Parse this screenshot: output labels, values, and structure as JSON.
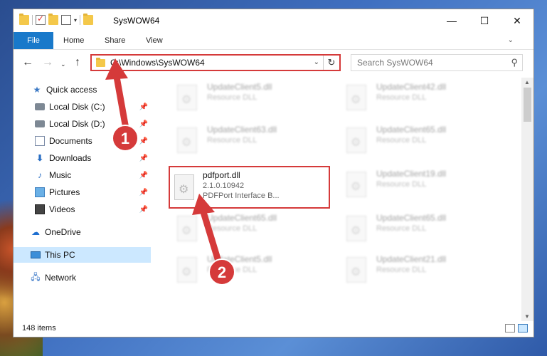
{
  "window": {
    "title": "SysWOW64",
    "minimize": "—",
    "maximize": "☐",
    "close": "✕"
  },
  "ribbon": {
    "tabs": [
      "File",
      "Home",
      "Share",
      "View"
    ],
    "expand": "⌄",
    "help": "?"
  },
  "nav": {
    "back": "←",
    "forward": "→",
    "recent": "⌄",
    "up": "↑",
    "address": "C:\\Windows\\SysWOW64",
    "search_placeholder": "Search SysWOW64"
  },
  "sidebar": {
    "items": [
      {
        "label": "Quick access",
        "icon": "star-icon"
      },
      {
        "label": "Local Disk (C:)",
        "icon": "disk-icon",
        "pinned": true
      },
      {
        "label": "Local Disk (D:)",
        "icon": "disk-icon",
        "pinned": true
      },
      {
        "label": "Documents",
        "icon": "documents-icon",
        "pinned": true
      },
      {
        "label": "Downloads",
        "icon": "download-icon",
        "pinned": true
      },
      {
        "label": "Music",
        "icon": "music-icon",
        "pinned": true
      },
      {
        "label": "Pictures",
        "icon": "pictures-icon",
        "pinned": true
      },
      {
        "label": "Videos",
        "icon": "videos-icon",
        "pinned": true
      },
      {
        "label": "OneDrive",
        "icon": "cloud-icon"
      },
      {
        "label": "This PC",
        "icon": "computer-icon",
        "selected": true
      },
      {
        "label": "Network",
        "icon": "network-icon"
      }
    ]
  },
  "files": {
    "left": [
      {
        "name": "UpdateClient5.dll",
        "type": "Resource DLL"
      },
      {
        "name": "UpdateClient63.dll",
        "type": "Resource DLL"
      },
      {
        "name": "pdfport.dll",
        "version": "2.1.0.10942",
        "type": "PDFPort Interface B...",
        "highlighted": true
      },
      {
        "name": "UpdateClient65.dll",
        "type": "Resource DLL"
      },
      {
        "name": "UpdateClient5.dll",
        "type": "Resource DLL"
      }
    ],
    "right": [
      {
        "name": "UpdateClient42.dll",
        "type": "Resource DLL"
      },
      {
        "name": "UpdateClient65.dll",
        "type": "Resource DLL"
      },
      {
        "name": "UpdateClient19.dll",
        "type": "Resource DLL"
      },
      {
        "name": "UpdateClient65.dll",
        "type": "Resource DLL"
      },
      {
        "name": "UpdateClient21.dll",
        "type": "Resource DLL"
      }
    ]
  },
  "status": {
    "item_count": "148 items"
  },
  "annotations": {
    "step1": "1",
    "step2": "2",
    "color": "#d53a3a"
  }
}
